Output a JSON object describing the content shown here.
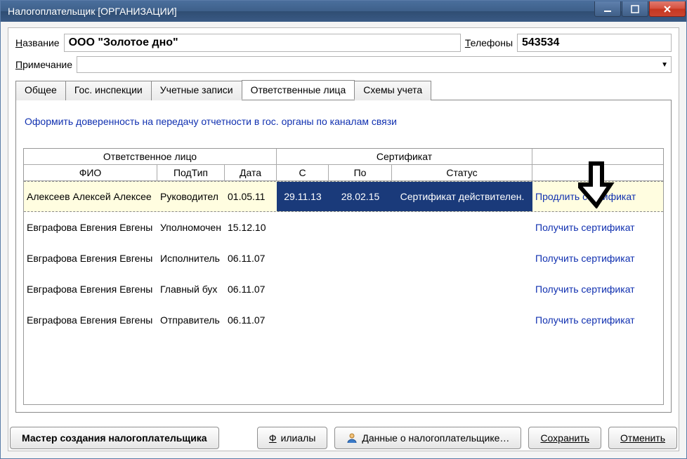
{
  "window": {
    "title": "Налогоплательщик [ОРГАНИЗАЦИИ]"
  },
  "fields": {
    "name_label_prefix": "Н",
    "name_label_rest": "азвание",
    "name_value": "ООО \"Золотое дно\"",
    "phones_label_prefix": "Т",
    "phones_label_rest": "елефоны",
    "phones_value": "543534",
    "note_label_prefix": "П",
    "note_label_rest": "римечание"
  },
  "tabs": {
    "t0": "Общее",
    "t1": "Гос. инспекции",
    "t2": "Учетные записи",
    "t3": "Ответственные лица",
    "t4": "Схемы учета",
    "active_index": 3
  },
  "top_link": "Оформить доверенность на передачу отчетности в гос. органы по каналам связи",
  "grid": {
    "group0": "Ответственное лицо",
    "group1": "Сертификат",
    "h_fio": "ФИО",
    "h_type": "ПодТип",
    "h_date": "Дата",
    "h_from": "С",
    "h_to": "По",
    "h_status": "Статус",
    "rows": [
      {
        "fio": "Алексеев Алексей Алексее",
        "type": "Руководител",
        "date": "01.05.11",
        "from": "29.11.13",
        "to": "28.02.15",
        "status": "Сертификат действителен.",
        "action": "Продлить сертификат",
        "selected": true
      },
      {
        "fio": "Евграфова Евгения Евгены",
        "type": "Уполномочен",
        "date": "15.12.10",
        "from": "",
        "to": "",
        "status": "",
        "action": "Получить сертификат",
        "selected": false
      },
      {
        "fio": "Евграфова Евгения Евгены",
        "type": "Исполнитель",
        "date": "06.11.07",
        "from": "",
        "to": "",
        "status": "",
        "action": "Получить сертификат",
        "selected": false
      },
      {
        "fio": "Евграфова Евгения Евгены",
        "type": "Главный бух",
        "date": "06.11.07",
        "from": "",
        "to": "",
        "status": "",
        "action": "Получить сертификат",
        "selected": false
      },
      {
        "fio": "Евграфова Евгения Евгены",
        "type": "Отправитель",
        "date": "06.11.07",
        "from": "",
        "to": "",
        "status": "",
        "action": "Получить сертификат",
        "selected": false
      }
    ]
  },
  "buttons": {
    "wizard": "Мастер создания налогоплательщика",
    "branches_prefix": "Ф",
    "branches_rest": "илиалы",
    "details_prefix": "Д",
    "details_rest": "анные о налогоплательщике…",
    "save": "Сохранить",
    "cancel": "Отменить"
  }
}
